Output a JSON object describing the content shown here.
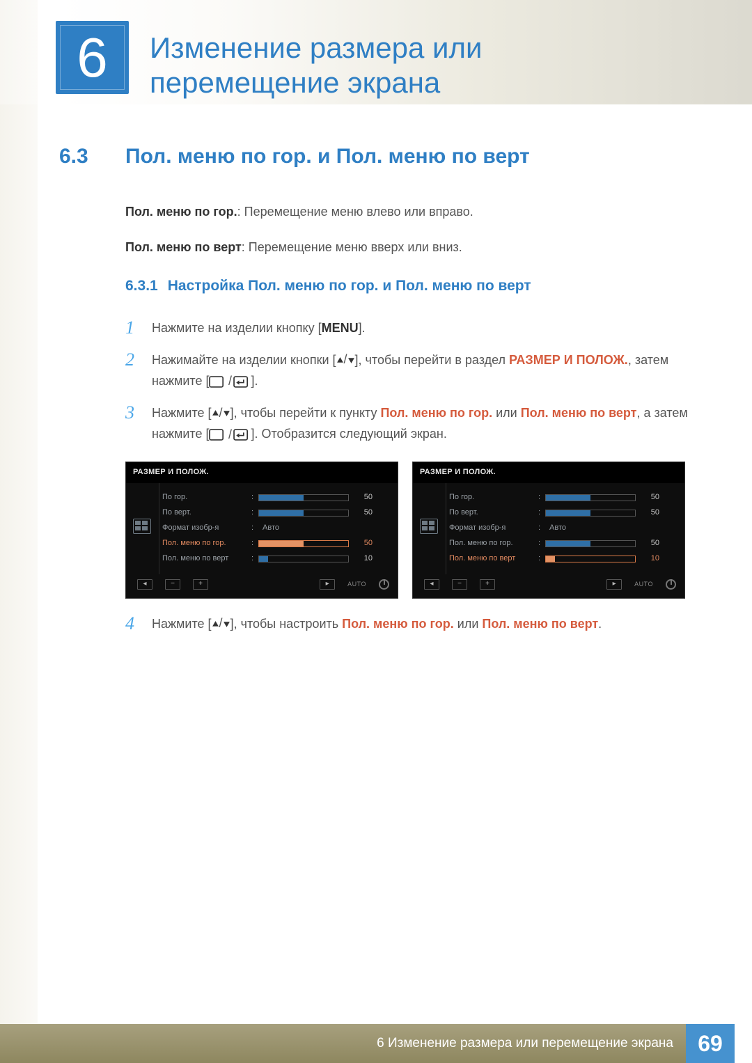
{
  "chapter": {
    "number": "6",
    "title": "Изменение размера или перемещение экрана"
  },
  "section63": {
    "number": "6.3",
    "title": "Пол. меню по гор. и Пол. меню по верт"
  },
  "intro": {
    "line1_label": "Пол. меню по гор.",
    "line1_text": ": Перемещение меню влево или вправо.",
    "line2_label": "Пол. меню по верт",
    "line2_text": ": Перемещение меню вверх или вниз."
  },
  "section631": {
    "number": "6.3.1",
    "title": "Настройка Пол. меню по гор. и Пол. меню по верт"
  },
  "steps": {
    "s1": {
      "n": "1",
      "pre": "Нажмите на изделии кнопку [",
      "menu": "MENU",
      "post": "]."
    },
    "s2": {
      "n": "2",
      "pre": "Нажимайте на изделии кнопки [",
      "mid1": "], чтобы перейти в раздел ",
      "target": "РАЗМЕР И ПОЛОЖ.",
      "mid2": ", затем нажмите [",
      "post": "]."
    },
    "s3": {
      "n": "3",
      "pre": "Нажмите [",
      "mid1": "], чтобы перейти к пункту ",
      "t1": "Пол. меню по гор.",
      "or": " или ",
      "t2": "Пол. меню по верт",
      "mid2": ", а затем нажмите [",
      "post": "]. Отобразится следующий экран."
    },
    "s4": {
      "n": "4",
      "pre": "Нажмите [",
      "mid1": "], чтобы настроить ",
      "t1": "Пол. меню по гор.",
      "or": " или ",
      "t2": "Пол. меню по верт",
      "post": "."
    }
  },
  "osd": {
    "title": "РАЗМЕР И ПОЛОЖ.",
    "rows": {
      "r1": {
        "label": "По гор.",
        "value": "50",
        "fill": 50
      },
      "r2": {
        "label": "По верт.",
        "value": "50",
        "fill": 50
      },
      "r3": {
        "label": "Формат изобр-я",
        "auto": "Авто"
      },
      "r4": {
        "label": "Пол. меню по гор.",
        "value": "50",
        "fill": 50
      },
      "r5": {
        "label": "Пол. меню по верт",
        "value": "10",
        "fill": 10
      }
    },
    "ctrls": {
      "auto": "AUTO"
    }
  },
  "footer": {
    "breadcrumb": "6 Изменение размера или перемещение экрана",
    "page": "69"
  }
}
